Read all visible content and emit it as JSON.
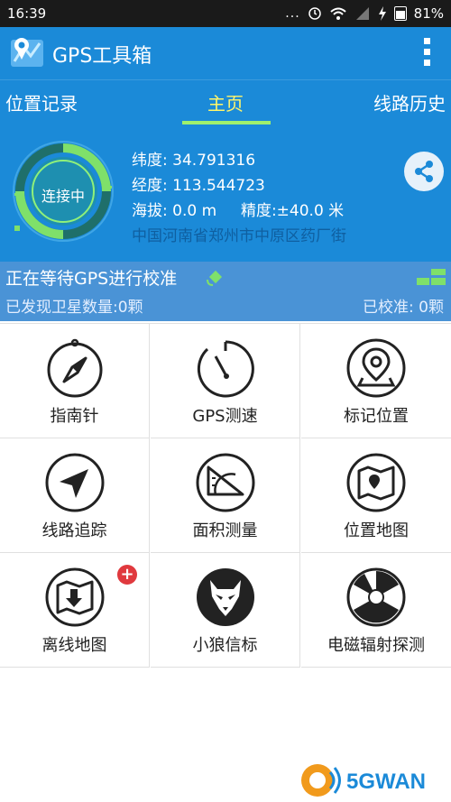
{
  "status_bar": {
    "time": "16:39",
    "dots": "...",
    "battery": "81%"
  },
  "app": {
    "title": "GPS工具箱"
  },
  "tabs": [
    {
      "label": "位置记录"
    },
    {
      "label": "主页"
    },
    {
      "label": "线路历史"
    }
  ],
  "gps": {
    "ring_label": "连接中",
    "latitude": "纬度: 34.791316",
    "longitude": "经度: 113.544723",
    "altitude": "海拔: 0.0 m",
    "accuracy": "精度:±40.0 米",
    "address": "中国河南省郑州市中原区药厂街"
  },
  "status": {
    "waiting": "正在等待GPS进行校准",
    "satellites": "已发现卫星数量:0颗",
    "calibrated": "已校准: 0颗"
  },
  "tools": [
    {
      "label": "指南针",
      "icon": "compass-icon"
    },
    {
      "label": "GPS测速",
      "icon": "speedometer-icon"
    },
    {
      "label": "标记位置",
      "icon": "map-pin-icon"
    },
    {
      "label": "线路追踪",
      "icon": "navigation-arrow-icon"
    },
    {
      "label": "面积测量",
      "icon": "protractor-icon"
    },
    {
      "label": "位置地图",
      "icon": "map-icon"
    },
    {
      "label": "离线地图",
      "icon": "offline-map-icon"
    },
    {
      "label": "小狼信标",
      "icon": "wolf-icon"
    },
    {
      "label": "电磁辐射探测",
      "icon": "radiation-icon"
    }
  ],
  "watermark": {
    "text": "5GWAN"
  },
  "colors": {
    "primary": "#1b8ad8",
    "tab_active": "#fff56a",
    "tab_indicator": "#9ff06c",
    "status_band": "#4a93d6",
    "badge": "#e0393e"
  }
}
